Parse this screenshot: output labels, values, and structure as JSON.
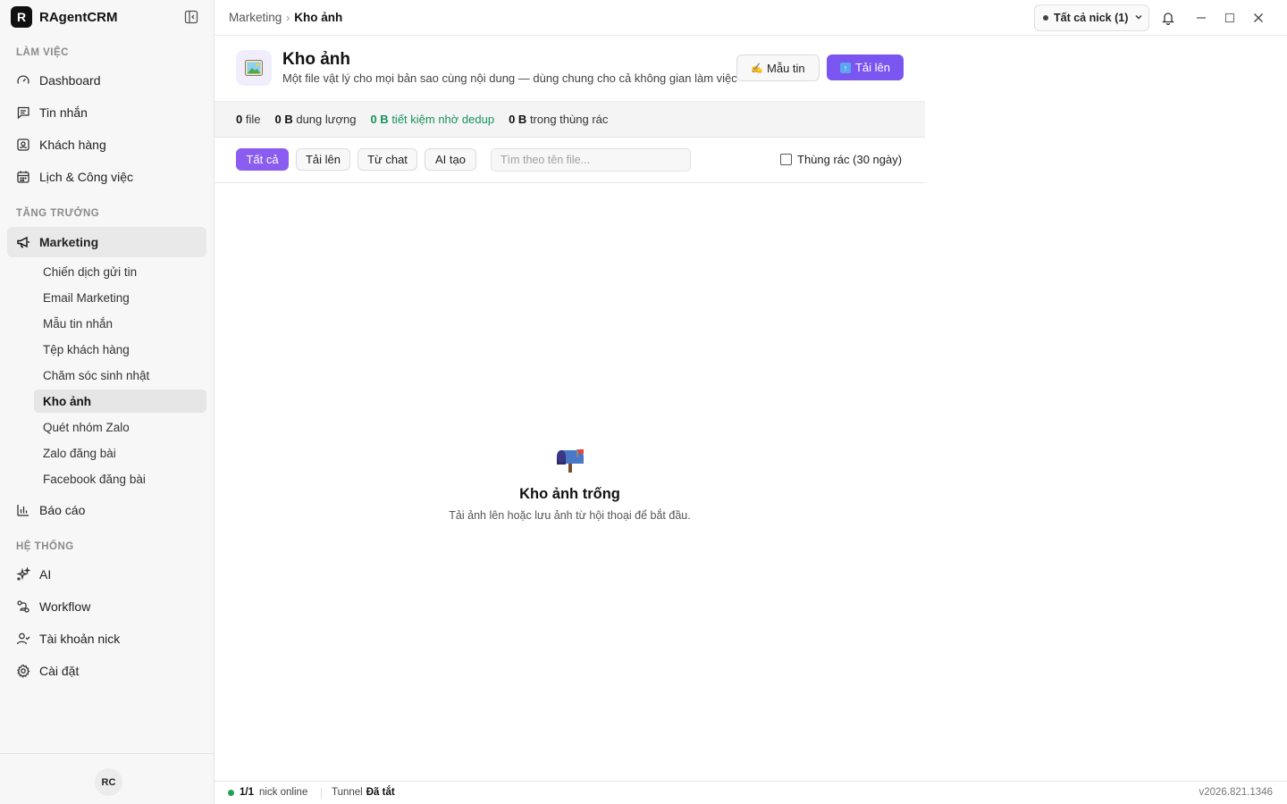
{
  "app": {
    "logo_letter": "R",
    "name": "RAgentCRM"
  },
  "sidebar": {
    "sections": {
      "work": "LÀM VIỆC",
      "growth": "TĂNG TRƯỞNG",
      "system": "HỆ THỐNG"
    },
    "items": {
      "dashboard": "Dashboard",
      "messages": "Tin nhắn",
      "customers": "Khách hàng",
      "calendar": "Lịch & Công việc",
      "marketing": "Marketing",
      "reports": "Báo cáo",
      "ai": "AI",
      "workflow": "Workflow",
      "nick_accounts": "Tài khoản nick",
      "settings": "Cài đặt"
    },
    "marketing_sub": [
      {
        "label": "Chiến dịch gửi tin"
      },
      {
        "label": "Email Marketing"
      },
      {
        "label": "Mẫu tin nhắn"
      },
      {
        "label": "Tệp khách hàng"
      },
      {
        "label": "Chăm sóc sinh nhật"
      },
      {
        "label": "Kho ảnh"
      },
      {
        "label": "Quét nhóm Zalo"
      },
      {
        "label": "Zalo đăng bài"
      },
      {
        "label": "Facebook đăng bài"
      }
    ],
    "avatar_initials": "RC"
  },
  "topbar": {
    "breadcrumb": {
      "parent": "Marketing",
      "current": "Kho ảnh"
    },
    "nick_select": "Tất cả nick (1)"
  },
  "header": {
    "title": "Kho ảnh",
    "subtitle": "Một file vật lý cho mọi bản sao cùng nội dung — dùng chung cho cả không gian làm việc",
    "template_button": "Mẫu tin",
    "template_emoji": "✍️",
    "upload_button": "Tải lên"
  },
  "stats": {
    "files_value": "0",
    "files_label": "file",
    "size_value": "0 B",
    "size_label": "dung lượng",
    "saved_value": "0 B",
    "saved_label": "tiết kiệm nhờ dedup",
    "trash_value": "0 B",
    "trash_label": "trong thùng rác"
  },
  "filters": {
    "tabs": [
      "Tất cả",
      "Tải lên",
      "Từ chat",
      "AI tạo"
    ],
    "search_placeholder": "Tìm theo tên file...",
    "trash_label": "Thùng rác (30 ngày)"
  },
  "empty_state": {
    "title": "Kho ảnh trống",
    "description": "Tải ảnh lên hoặc lưu ảnh từ hội thoại để bắt đầu."
  },
  "statusbar": {
    "online_count": "1/1",
    "online_label": "nick online",
    "tunnel_label": "Tunnel",
    "tunnel_value": "Đã tắt",
    "version": "v2026.821.1346"
  },
  "colors": {
    "accent": "#7b55f0",
    "green": "#17925b",
    "online": "#1fa251"
  }
}
